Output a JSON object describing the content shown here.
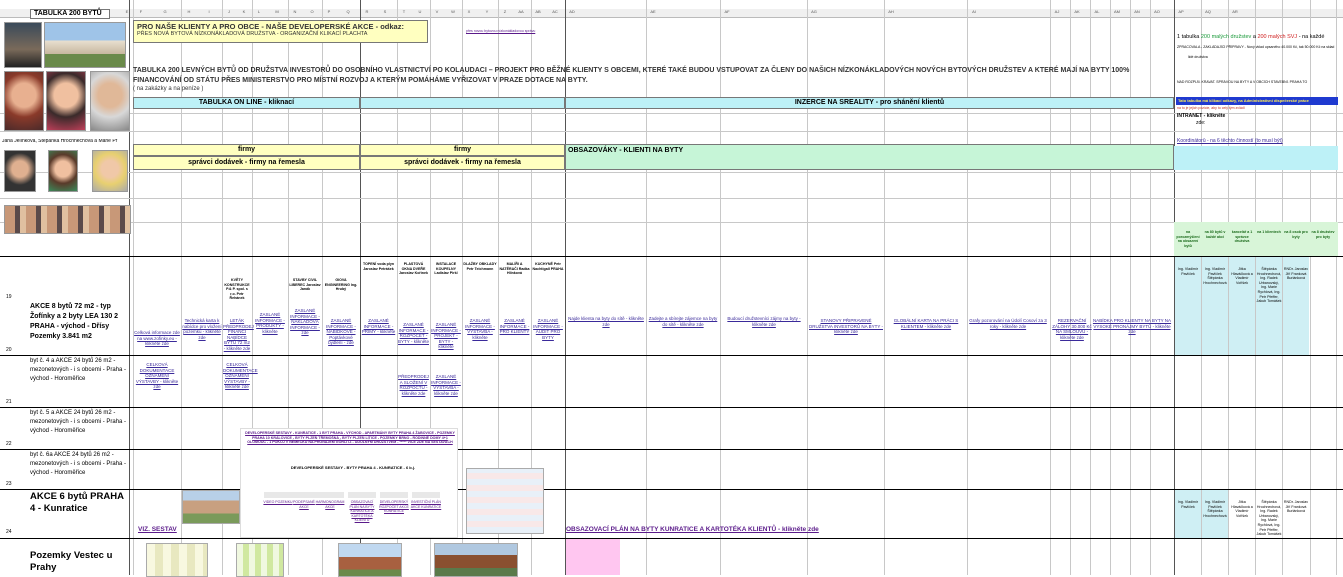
{
  "colors": {
    "yellow_header": "#ffffc0",
    "cyan_header": "#bdf1f7",
    "green_header": "#c6f5d7",
    "pink_cell": "#ffc6f0",
    "link_text": "#3a2a9a",
    "blue_bar": "#1f3ad0"
  },
  "sheet": {
    "title": "TABULKA 200 BYTŮ",
    "column_letters": [
      "E",
      "F",
      "G",
      "H",
      "I",
      "J",
      "K",
      "L",
      "M",
      "N",
      "O",
      "P",
      "Q",
      "R",
      "S",
      "T",
      "U",
      "V",
      "W",
      "X",
      "Y",
      "Z",
      "AA",
      "AB",
      "AC",
      "AD",
      "AE",
      "AF",
      "AG",
      "AH",
      "AI",
      "AJ",
      "AK",
      "AL",
      "AM",
      "AN",
      "AO",
      "AP",
      "AQ",
      "AR"
    ],
    "row_numbers": [
      "19",
      "20",
      "21",
      "22",
      "23",
      "24"
    ]
  },
  "header": {
    "promo_title": "PRO NAŠE KLIENTY A PRO OBCE - NAŠE DEVELOPERSKÉ AKCE - odkaz:",
    "promo_subtitle": "PŘES NOVÁ BYTOVÁ NÍZKONÁKLADOVÁ DRUŽSTVA - ORGANIZAČNÍ KLIKACÍ PLACHTA",
    "tiny_link": "přes novou bytovou nízkonákladovou správu",
    "main_paragraph": "TABULKA 200 LEVNÝCH BYTŮ OD DRUŽSTVA INVESTORŮ DO OSOBNÍHO VLASTNICTVÍ PO KOLAUDACI – PROJEKT PRO BĚŽNÉ KLIENTY S OBCEMI, KTERÉ TAKÉ BUDOU VSTUPOVAT ZA ČLENY DO NAŠICH NÍZKONÁKLADOVÝCH NOVÝCH BYTOVÝCH DRUŽSTEV A KTERÉ MAJÍ NA BYTY 100% FINANCOVÁNÍ OD STÁTU PŘES MINISTERSTVO PRO MÍSTNÍ ROZVOJ A KTERÝM POMÁHÁME VYŘIZOVAT V PRAZE DOTACE NA BYTY.",
    "sub_paragraph": "( na zakázky a na peníze )",
    "people_caption": "Jana Jelínková, Štěpánka Hrochnechová a Marie Pr",
    "right_line1_prefix": "1 tabulka",
    "right_line1_green": "200 malých družstev",
    "right_line1_mid": "a",
    "right_line1_red": "200 malých SVJ",
    "right_line1_suffix": "- na každé",
    "right_line2": "ZPRACOVALA - ZAKLÁDAJÍCÍ PŘÍPRAVY - Nový vklad upsaného 40.000 Kč, tak 50.000 Kč na sklad",
    "right_line3": "lidé družstva",
    "right_note": "NAD ROZPLŇ. KRAVAT. SPRÁVOU NA BYTY A V OBCÍCH STAVEBNÍ. PRAHA TO"
  },
  "sections": {
    "online_table": "TABULKA ON LINE - kliknací",
    "sreality": "INZERCE NA SREALITY - pro shánění klientů",
    "blue_bar_text": "Tato tabulka má klikací odkazy, na Administrativní dispečerské práce",
    "intranet_label": "INTRANET - klikněte",
    "intranet_sub": "zde:",
    "firms_label": "firmy",
    "firms_sub": "správci dodávek - firmy na řemesla",
    "occupancy_label": "OBSAZOVÁKY - KLIENTI NA BYTY",
    "coordinators": "Koordinátorů - na 6 těchto činností (to musí být)",
    "right_small_link": "na to je jejich pozicie, aby to celý tým zvládl"
  },
  "rows": [
    {
      "num": "19",
      "label": "AKCE 8 bytů 72 m2 - typ Žofínky a 2 byty LEA 130 2 PRAHA - východ - Dřísy Pozemky 3.841 m2",
      "links": [
        "Celková informace zde na www.zofinky.eu - klikněte zde",
        "Technická karta k nabídce pro vložení pozemku - klikněte zde",
        "LETÁK PŘEDPRODEJ FINANCÍ NABÍDCE BYTŮ 72 m2 - klikněte zde",
        "ZASLANÉ INFORMACE - PRODUKTY - klikněte",
        "ZASLANÉ INFORMACE - NÁKLADOVÁ INFORMACE - zde",
        "ZASLANÉ INFORMACE - NABÍDKOVÉ - Poptávkové bydlení - zde",
        "ZASLANÉ INFORMACE - PRIMY - klikněte",
        "ZASLANÉ INFORMACE - ROZPOČET - BYTY - klikněte",
        "ZASLANÉ INFORMACE - PROJEKT - BYTY - klikněte",
        "ZASLANÉ INFORMACE - VÝSTAVBA - klikněte",
        "ZASLANÉ INFORMACE - PRO KLIENTY",
        "ZASLANÉ INFORMACE - AUDIT PRO BYTY"
      ],
      "firm_heads": [
        "KVĚTY KONSTRUKCE P.& P. spol. s r.o. Petr Řehánek",
        "STAVBY CIVIL LIBEREC Jaroslav Janák",
        "GIOVA ENGINEERING Ing. Hrubý",
        "TOPENÍ voda plyn Jaroslav Petrášek",
        "PLASTOVÁ OKNA DVEŘE Jaroslav Kořínek",
        "INSTALACE KOUPELNY Ladislav Pirkl",
        "DLAŽBY OBKLADY Petr Teichmann",
        "MALÍŘI A NATĚRAČI Radka Hlinková",
        "KUCHYNĚ Petr Nachtigall PRAHA"
      ],
      "sreality_links": [
        "Najde klienta na byty do sítě - klikněte zde",
        "Zadejte a sbírejte zájemce na byty do sítě - klikněte zde",
        "Budoucí družstevníci zájmy na byty - klikněte zde",
        "STANOVY PŘIPRAVENÉ DRUŽSTVA INVESTORŮ NA BYTY - klikněte zde",
        "GLOBÁLNÍ KARTA NA PRÁCI S KLIENTEM - klikněte zde",
        "Grafy pozorování na Údolí Cosoví za 3 roky - klikněte zde",
        "REZERVAČNÍ ZÁLOHY 30.000 Kč NA SMLOUVU - klikněte zde",
        "NABÍDKA PRO KLIENTY NA BYTY NA VYSOKÉ PRONÁJMY BYTŮ - klikněte zde"
      ]
    },
    {
      "num": "20",
      "label": "byt č. 4 a AKCE 24 bytů 26 m2 - mezonetových - i s obcemi - Praha - východ - Horoměřice",
      "links": [
        "CELKOVÁ DOKUMENTACE OZNÁMENÍ VÝSTAVBY - klikněte zde",
        "CELKOVÁ DOKUMENTACE OZNÁMENÍ VÝSTAVBY - klikněte zde",
        "PŘEDPRODEJ A SLOŽENÍ V ROZPOČTU - klikněte zde",
        "ZASLANÉ INFORMACE - VÝSTAVBA - klikněte zde"
      ]
    },
    {
      "num": "21",
      "label": "byt č. 5 a AKCE 24 bytů 26 m2 - mezonetových - i s obcemi - Praha - východ - Horoměřice",
      "dev_title": "DEVELOPERSKÉ SESTAVY - KUNRATICE - 1 BYT PRAHA - VÝCHOD - APARTMÁNY BYTY PRAHA 4 ŽABOVICE - POZEMKY PRAHA 10 KRÁLOVICE - BYTY PLZEŇ TŘEMOŠNÁ - BYTY PLZEŇ LITICE - POZEMKY BRNO - RODINNÉ DOMY 4+1 OLOMOUC - 1 POKOJ V NĚMECKU NA PRONAJEM GÖRLITZ - UDOLNÝM DRUŽSTVEM - ***** VICE ZDE NA SESTAVÁCH",
      "dev_sub": "DEVELOPERSKÉ SESTAVY - BYTY PRAHA 4 - KUNRATICE - 6 b.j.",
      "dev_items": [
        "VIDEO POZEMKU",
        "PODEPSANÉ AKCE",
        "HARMONOGRAM AKCE",
        "OBSAZOVACÍ PLÁN NA BYTY KUNRATICE A KARTOTÉKA KLIENTŮ",
        "DEVELOPERSKÝ ROZPOČET AKCE KUNRATICE",
        "INVESTIČNÍ PLÁN AKCE KUNRATICE"
      ]
    },
    {
      "num": "22",
      "label": "byt č. 6a AKCE 24 bytů 26 m2 - mezonetových - i s obcemi - Praha - východ - Horoměřice"
    },
    {
      "num": "23",
      "label": "AKCE 6 bytů PRAHA 4 - Kunratice",
      "viz_link": "VIZ. SESTAV",
      "plan_link": "OBSAZOVACÍ PLÁN NA BYTY KUNRATICE A KARTOTÉKA KLIENTŮ - klikněte zde"
    },
    {
      "num": "24",
      "label": "Pozemky Vestec u Prahy"
    }
  ],
  "coordinator_cells": [
    "Ing. Vladimír Pavlíček",
    "Ing. Vladimír Pavlíček Štěpánka Hrochnechová",
    "Jitka Hlaváčková a Vladimír Voříšek",
    "Štěpánka Hrochnechová, Ing. Radek Urbanovský, Ing. Marie Rychlová, Ing. Petr Pfeffer, Jakub Tomášek",
    "RNDr. Jaroslav Jiří Franková Buriánková"
  ],
  "right_green_heads": [
    "na porozmýšlení na obsazení bytů",
    "na 80 bytů v každé akci",
    "kancelář a 1 správce družstva",
    "na 1 klientech",
    "na 8 osob pro byty",
    "na 8 družstev pro byty"
  ]
}
